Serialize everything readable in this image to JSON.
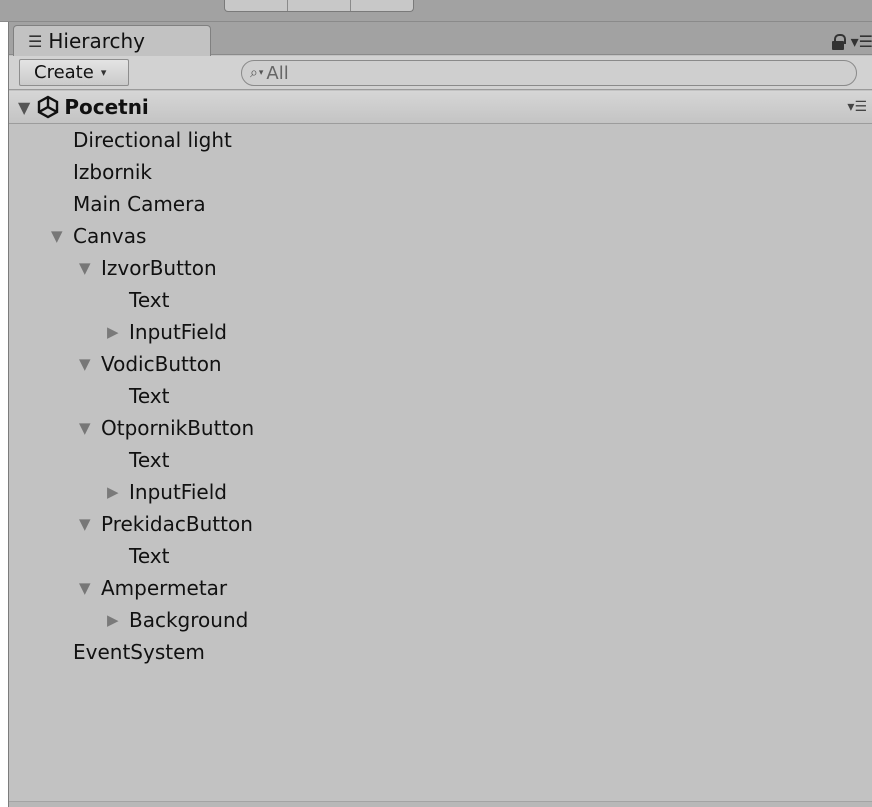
{
  "panel": {
    "tab_title": "Hierarchy",
    "tab_icon": "list-icon"
  },
  "toolbar": {
    "create_label": "Create",
    "search_placeholder": "All"
  },
  "scene": {
    "name": "Pocetni",
    "icon": "unity-logo-icon"
  },
  "tree": [
    {
      "label": "Directional light",
      "depth": 0,
      "expander": "none"
    },
    {
      "label": "Izbornik",
      "depth": 0,
      "expander": "none"
    },
    {
      "label": "Main Camera",
      "depth": 0,
      "expander": "none"
    },
    {
      "label": "Canvas",
      "depth": 0,
      "expander": "expanded"
    },
    {
      "label": "IzvorButton",
      "depth": 1,
      "expander": "expanded"
    },
    {
      "label": "Text",
      "depth": 2,
      "expander": "none"
    },
    {
      "label": "InputField",
      "depth": 2,
      "expander": "collapsed"
    },
    {
      "label": "VodicButton",
      "depth": 1,
      "expander": "expanded"
    },
    {
      "label": "Text",
      "depth": 2,
      "expander": "none"
    },
    {
      "label": "OtpornikButton",
      "depth": 1,
      "expander": "expanded"
    },
    {
      "label": "Text",
      "depth": 2,
      "expander": "none"
    },
    {
      "label": "InputField",
      "depth": 2,
      "expander": "collapsed"
    },
    {
      "label": "PrekidacButton",
      "depth": 1,
      "expander": "expanded"
    },
    {
      "label": "Text",
      "depth": 2,
      "expander": "none"
    },
    {
      "label": "Ampermetar",
      "depth": 1,
      "expander": "expanded"
    },
    {
      "label": "Background",
      "depth": 2,
      "expander": "collapsed"
    },
    {
      "label": "EventSystem",
      "depth": 0,
      "expander": "none"
    }
  ]
}
